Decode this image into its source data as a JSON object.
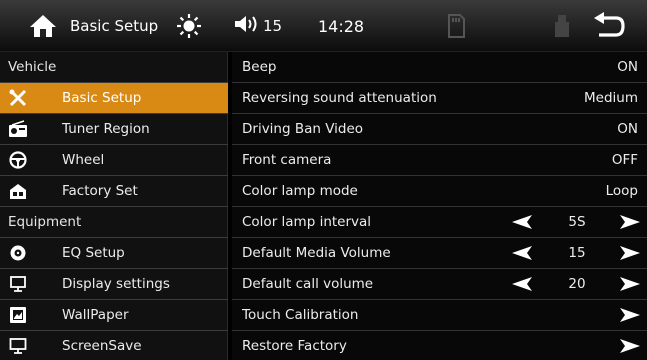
{
  "topbar": {
    "home_icon": "home-icon",
    "title": "Basic Setup",
    "brightness_icon": "sun-icon",
    "volume_icon": "speaker-icon",
    "volume_level": "15",
    "time": "14:28",
    "sd_icon": "sd-card-icon",
    "usb_icon": "usb-icon",
    "back_icon": "back-arrow-icon"
  },
  "sidebar": {
    "sections": [
      {
        "header": "Vehicle",
        "items": [
          {
            "label": "Basic Setup",
            "icon": "tools-icon",
            "active": true
          },
          {
            "label": "Tuner Region",
            "icon": "radio-icon",
            "active": false
          },
          {
            "label": "Wheel",
            "icon": "steering-wheel-icon",
            "active": false
          },
          {
            "label": "Factory Set",
            "icon": "factory-icon",
            "active": false
          }
        ]
      },
      {
        "header": "Equipment",
        "items": [
          {
            "label": "EQ Setup",
            "icon": "eq-icon",
            "active": false
          },
          {
            "label": "Display settings",
            "icon": "display-icon",
            "active": false
          },
          {
            "label": "WallPaper",
            "icon": "wallpaper-icon",
            "active": false
          },
          {
            "label": "ScreenSave",
            "icon": "monitor-icon",
            "active": false
          }
        ]
      }
    ],
    "accent_color": "#d88a14"
  },
  "settings": [
    {
      "label": "Beep",
      "value": "ON"
    },
    {
      "label": "Reversing sound attenuation",
      "value": "Medium"
    },
    {
      "label": "Driving Ban Video",
      "value": "ON"
    },
    {
      "label": "Front camera",
      "value": "OFF"
    },
    {
      "label": "Color lamp mode",
      "value": "Loop"
    },
    {
      "label": "Color lamp interval",
      "value": "5S",
      "stepper": true
    },
    {
      "label": "Default Media Volume",
      "value": "15",
      "stepper": true
    },
    {
      "label": "Default call volume",
      "value": "20",
      "stepper": true
    },
    {
      "label": "Touch Calibration",
      "arrow": true
    },
    {
      "label": "Restore Factory",
      "arrow": true
    }
  ]
}
